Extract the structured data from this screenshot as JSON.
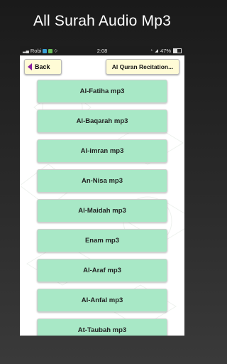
{
  "promo": {
    "title": "All Surah Audio Mp3"
  },
  "status_bar": {
    "carrier": "Robi",
    "time": "2:08",
    "battery": "47%"
  },
  "toolbar": {
    "back_label": "Back",
    "recitation_label": "Al Quran Recitation..."
  },
  "surahs": [
    {
      "label": "Al-Fatiha mp3"
    },
    {
      "label": "Al-Baqarah mp3"
    },
    {
      "label": "Al-imran mp3"
    },
    {
      "label": "An-Nisa mp3"
    },
    {
      "label": "Al-Maidah mp3"
    },
    {
      "label": "Enam mp3"
    },
    {
      "label": "Al-Araf mp3"
    },
    {
      "label": "Al-Anfal mp3"
    },
    {
      "label": "At-Taubah mp3"
    }
  ],
  "colors": {
    "item_bg": "#a8e8c6",
    "button_bg": "#fffbd6",
    "back_arrow": "#8a1fa0"
  },
  "icons": [
    "back-arrow-icon",
    "wifi-icon",
    "signal-icon",
    "battery-icon",
    "notification-icon"
  ]
}
